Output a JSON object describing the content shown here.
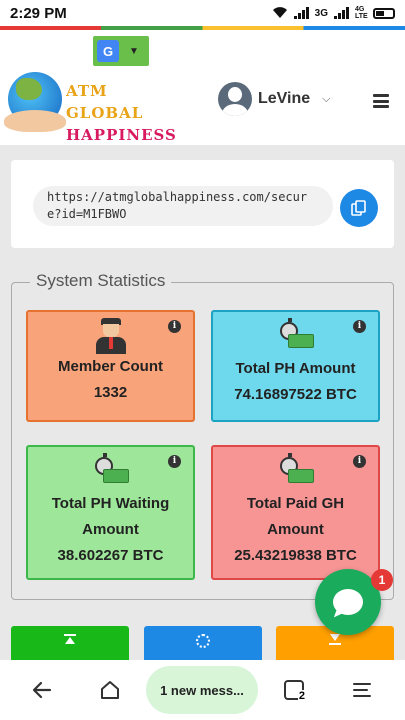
{
  "status_bar": {
    "time": "2:29 PM",
    "network": "3G",
    "network2": "4G LTE"
  },
  "header": {
    "translate_label": "G",
    "logo_line1": "ATM GLOBAL",
    "logo_line2": "HAPPINESS",
    "user_name": "LeVine"
  },
  "referral": {
    "url": "https://atmglobalhappiness.com/secure?id=M1FBWO"
  },
  "stats": {
    "legend": "System Statistics",
    "cards": [
      {
        "title": "Member Count",
        "value": "1332"
      },
      {
        "title": "Total PH Amount",
        "value": "74.16897522 BTC"
      },
      {
        "title": "Total PH Waiting Amount",
        "value": "38.602267 BTC"
      },
      {
        "title": "Total Paid GH Amount",
        "value": "25.43219838 BTC"
      }
    ]
  },
  "chat": {
    "badge": "1"
  },
  "nav": {
    "message_label": "1 new mess...",
    "tabs_count": "2"
  },
  "colors": {
    "member_bg": "#f8a37a",
    "ph_bg": "#6ed8ec",
    "waiting_bg": "#9ee79a",
    "paid_bg": "#f79595",
    "chat": "#1aab5c"
  }
}
